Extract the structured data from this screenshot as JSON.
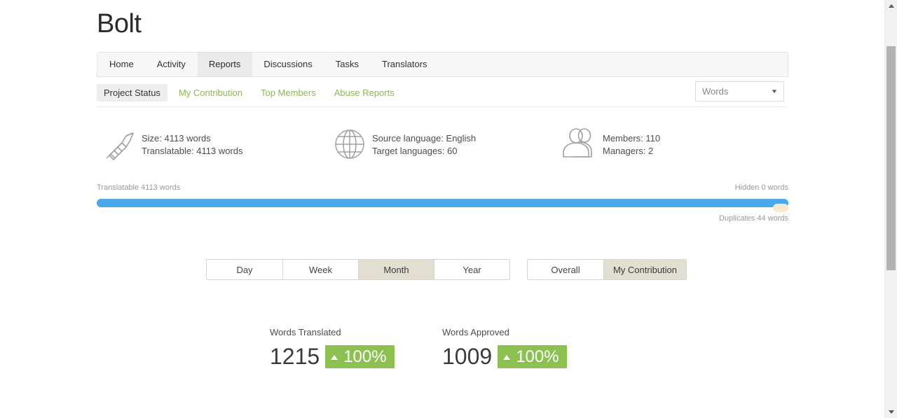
{
  "project": {
    "title": "Bolt"
  },
  "nav": {
    "tabs": [
      {
        "label": "Home",
        "active": false
      },
      {
        "label": "Activity",
        "active": false
      },
      {
        "label": "Reports",
        "active": true
      },
      {
        "label": "Discussions",
        "active": false
      },
      {
        "label": "Tasks",
        "active": false
      },
      {
        "label": "Translators",
        "active": false
      }
    ]
  },
  "subnav": {
    "items": [
      {
        "label": "Project Status",
        "active": true
      },
      {
        "label": "My Contribution",
        "active": false
      },
      {
        "label": "Top Members",
        "active": false
      },
      {
        "label": "Abuse Reports",
        "active": false
      }
    ]
  },
  "units_select": {
    "value": "Words",
    "caret": "▼"
  },
  "summary": {
    "size": {
      "icon": "caliper-icon",
      "line1": "Size: 4113 words",
      "line2": "Translatable: 4113 words"
    },
    "languages": {
      "icon": "globe-icon",
      "line1": "Source language: English",
      "line2": "Target languages: 60"
    },
    "people": {
      "icon": "users-icon",
      "line1": "Members: 110",
      "line2": "Managers: 2"
    }
  },
  "progress": {
    "left_label": "Translatable 4113 words",
    "right_label": "Hidden 0 words",
    "bottom_label": "Duplicates 44 words",
    "translatable_percent": 100,
    "hidden_percent": 0,
    "duplicates_percent": 1.07,
    "bar_color": "#4aa8ec",
    "duplicates_color": "#f5ead0"
  },
  "period_buttons": {
    "range": [
      {
        "label": "Day",
        "active": false
      },
      {
        "label": "Week",
        "active": false
      },
      {
        "label": "Month",
        "active": true
      },
      {
        "label": "Year",
        "active": false
      }
    ],
    "scope": [
      {
        "label": "Overall",
        "active": false
      },
      {
        "label": "My Contribution",
        "active": true
      }
    ]
  },
  "stats": [
    {
      "label": "Words Translated",
      "value": "1215",
      "delta": "100%",
      "direction": "up",
      "badge_color": "#8cc152"
    },
    {
      "label": "Words Approved",
      "value": "1009",
      "delta": "100%",
      "direction": "up",
      "badge_color": "#8cc152"
    }
  ],
  "scrollbar": {
    "up_arrow": "▲",
    "down_arrow": "▼"
  }
}
